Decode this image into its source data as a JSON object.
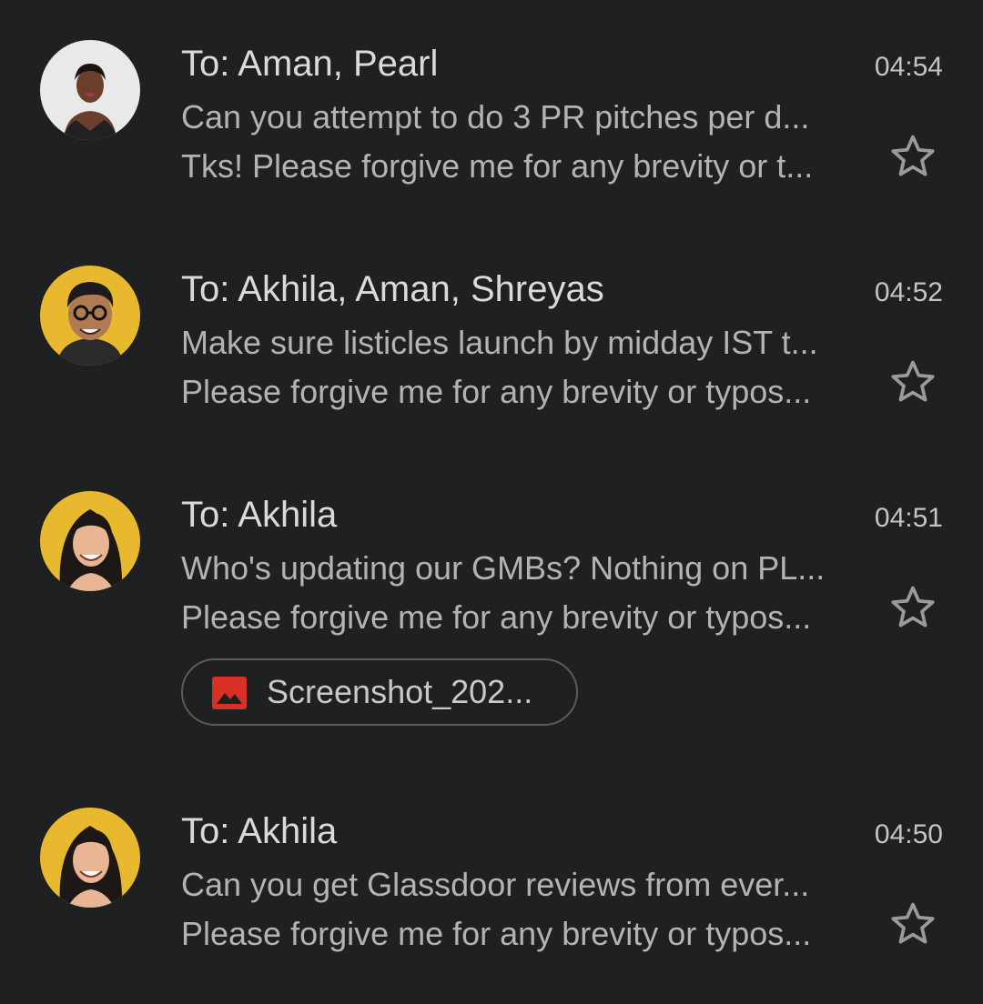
{
  "emails": [
    {
      "to": "To: Aman, Pearl",
      "time": "04:54",
      "subject": "Can you attempt to do 3 PR pitches per d...",
      "snippet": "Tks! Please forgive me for any brevity or t...",
      "starred": false,
      "avatar": "person-photo"
    },
    {
      "to": "To: Akhila, Aman, Shreyas",
      "time": "04:52",
      "subject": "Make sure listicles launch by midday IST t...",
      "snippet": "Please forgive me for any brevity or typos...",
      "starred": false,
      "avatar": "cartoon-man-glasses"
    },
    {
      "to": "To: Akhila",
      "time": "04:51",
      "subject": "Who's updating our GMBs? Nothing on PL...",
      "snippet": "Please forgive me for any brevity or typos...",
      "starred": false,
      "avatar": "cartoon-woman",
      "attachment": {
        "name": "Screenshot_202...",
        "icon": "image-icon",
        "icon_color": "#d93025"
      }
    },
    {
      "to": "To: Akhila",
      "time": "04:50",
      "subject": "Can you get Glassdoor reviews from ever...",
      "snippet": "Please forgive me for any brevity or typos...",
      "starred": false,
      "avatar": "cartoon-woman"
    }
  ],
  "colors": {
    "background": "#1f2021",
    "avatar_yellow": "#e8b82f",
    "star_outline": "#9a9a9a"
  }
}
